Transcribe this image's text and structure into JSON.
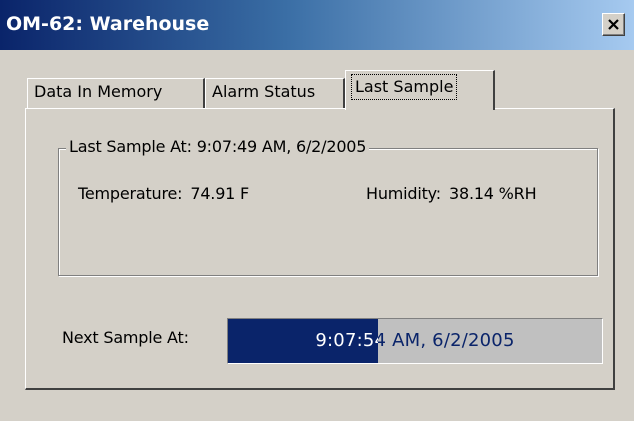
{
  "window": {
    "title": "OM-62: Warehouse",
    "close_icon": "close-icon"
  },
  "tabs": [
    {
      "label": "Data In Memory",
      "active": false
    },
    {
      "label": "Alarm Status",
      "active": false
    },
    {
      "label": "Last Sample",
      "active": true
    }
  ],
  "last_sample": {
    "group_title": "Last Sample At: 9:07:49 AM, 6/2/2005",
    "temperature_label": "Temperature:",
    "temperature_value": "74.91 F",
    "humidity_label": "Humidity:",
    "humidity_value": "38.14 %RH"
  },
  "next_sample": {
    "label": "Next Sample At:",
    "value": "9:07:54 AM, 6/2/2005",
    "progress_fraction": 0.4
  },
  "colors": {
    "titlebar_start": "#0a246a",
    "titlebar_end": "#a6caf0",
    "window_face": "#d4d0c8",
    "progress_fill": "#0a246a",
    "progress_track": "#c0c0c0"
  }
}
